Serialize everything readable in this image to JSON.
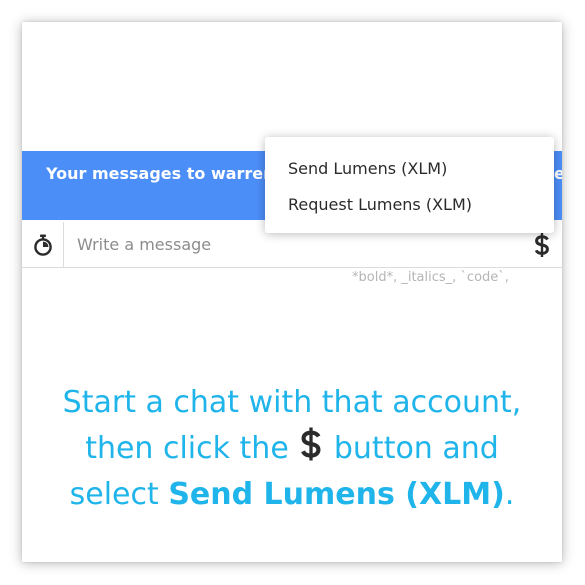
{
  "banner": {
    "text_left": "Your messages to warrenb",
    "text_right": "e"
  },
  "composer": {
    "placeholder": "Write a message",
    "format_hint": "*bold*, _italics_, `code`,"
  },
  "payment_menu": {
    "items": [
      {
        "label": "Send Lumens (XLM)"
      },
      {
        "label": "Request Lumens (XLM)"
      }
    ]
  },
  "instructions": {
    "line1": "Start a chat with that account,",
    "line2_before": "then click the",
    "line2_after": "button and",
    "line3_before": "select",
    "line3_bold": "Send Lumens (XLM)",
    "line3_after": "."
  },
  "colors": {
    "banner_blue": "#4c8ef8",
    "instruction_cyan": "#1fb4ea",
    "icon_dark": "#2b2b2b"
  },
  "icons": {
    "timer": "stopwatch-icon",
    "payment": "dollar-icon"
  }
}
